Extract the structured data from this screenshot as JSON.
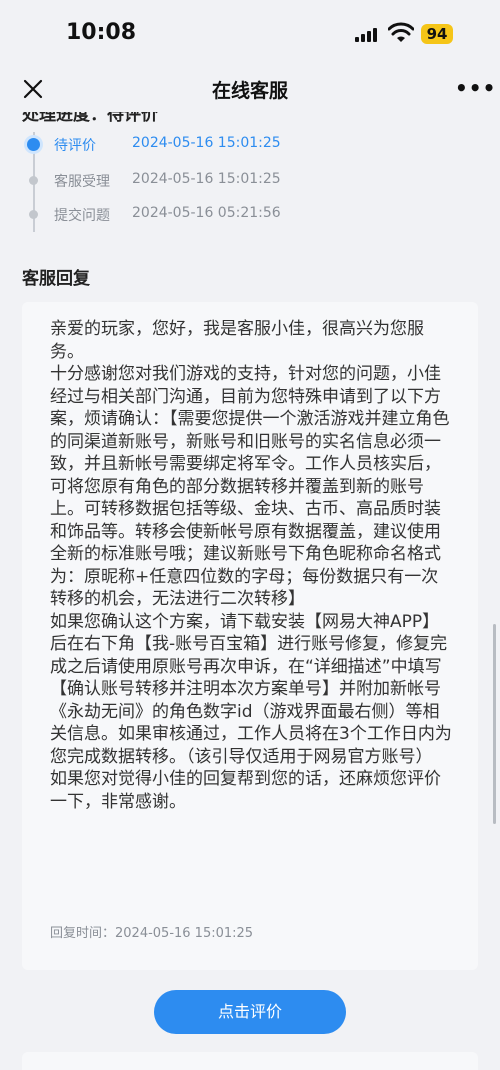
{
  "status_bar": {
    "time": "10:08",
    "battery": "94",
    "signal_icon": "signal-icon",
    "wifi_icon": "wifi-icon"
  },
  "nav": {
    "title": "在线客服",
    "close_icon": "close-icon",
    "more_icon": "more-icon"
  },
  "progress": {
    "title": "处理进度：待评价",
    "steps": [
      {
        "label": "待评价",
        "time": "2024-05-16 15:01:25",
        "active": true
      },
      {
        "label": "客服受理",
        "time": "2024-05-16 15:01:25",
        "active": false
      },
      {
        "label": "提交问题",
        "time": "2024-05-16 05:21:56",
        "active": false
      }
    ]
  },
  "reply": {
    "section_title": "客服回复",
    "paragraphs": [
      "亲爱的玩家，您好，我是客服小佳，很高兴为您服务。",
      "十分感谢您对我们游戏的支持，针对您的问题，小佳经过与相关部门沟通，目前为您特殊申请到了以下方案，烦请确认：【需要您提供一个激活游戏并建立角色的同渠道新账号，新账号和旧账号的实名信息必须一致，并且新帐号需要绑定将军令。工作人员核实后，可将您原有角色的部分数据转移并覆盖到新的账号上。可转移数据包括等级、金块、古币、高品质时装和饰品等。转移会使新帐号原有数据覆盖，建议使用全新的标准账号哦；建议新账号下角色昵称命名格式为：原昵称+任意四位数的字母；每份数据只有一次转移的机会，无法进行二次转移】",
      "如果您确认这个方案，请下载安装【网易大神APP】后在右下角【我-账号百宝箱】进行账号修复，修复完成之后请使用原账号再次申诉，在“详细描述”中填写【确认账号转移并注明本次方案单号】并附加新帐号《永劫无间》的角色数字id（游戏界面最右侧）等相关信息。如果审核通过，工作人员将在3个工作日内为您完成数据转移。（该引导仅适用于网易官方账号）",
      "如果您对觉得小佳的回复帮到您的话，还麻烦您评价一下，非常感谢。"
    ],
    "time_text": "回复时间：2024-05-16 15:01:25"
  },
  "actions": {
    "rate_button": "点击评价"
  },
  "colors": {
    "accent": "#2d8cf0",
    "background": "#f1f2f5",
    "card": "#f7f8fa",
    "battery": "#f5c518"
  }
}
